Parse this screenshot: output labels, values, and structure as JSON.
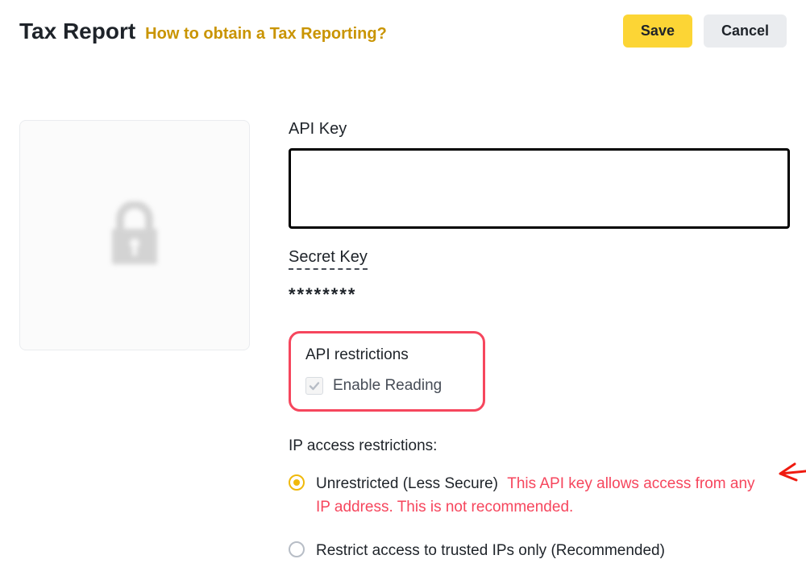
{
  "header": {
    "title": "Tax Report",
    "help_link": "How to obtain a Tax Reporting?",
    "save_label": "Save",
    "cancel_label": "Cancel"
  },
  "form": {
    "api_key_label": "API Key",
    "api_key_value": "",
    "secret_key_label": "Secret Key",
    "secret_key_value": "********"
  },
  "restrictions": {
    "title": "API restrictions",
    "enable_reading_label": "Enable Reading",
    "enable_reading_checked": true
  },
  "ip": {
    "title": "IP access restrictions:",
    "options": [
      {
        "label": "Unrestricted (Less Secure)",
        "warning": "This API key allows access from any IP address. This is not recommended.",
        "selected": true
      },
      {
        "label": "Restrict access to trusted IPs only (Recommended)",
        "warning": "",
        "selected": false
      }
    ]
  },
  "colors": {
    "accent": "#fcd535",
    "danger": "#f6465d",
    "link": "#c99400"
  }
}
